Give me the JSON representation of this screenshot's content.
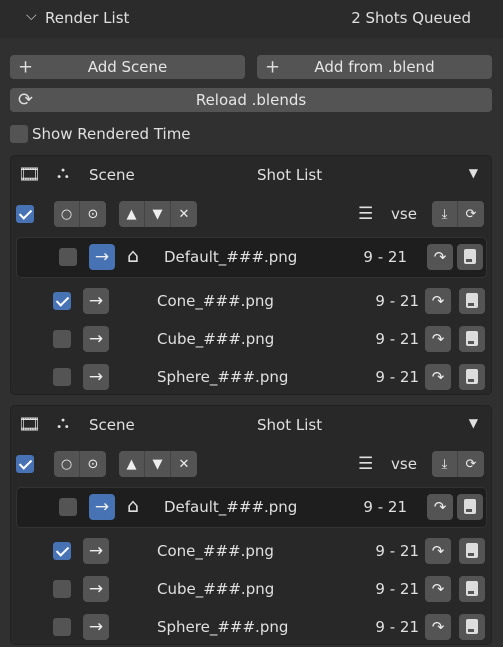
{
  "header": {
    "title": "Render List",
    "status": "2 Shots Queued"
  },
  "toolbar": {
    "add_scene": "Add Scene",
    "add_from_blend": "Add from .blend",
    "reload": "Reload .blends",
    "show_rendered_time": "Show Rendered Time",
    "show_rendered_time_checked": false
  },
  "colors": {
    "accent": "#4772b3",
    "button": "#545454",
    "panel": "#303030"
  },
  "blocks": [
    {
      "scene": "Scene",
      "list": "Shot List",
      "enabled": true,
      "collection": "vse",
      "default": {
        "name": "Default_###.png",
        "range": "9 - 21",
        "checked": false
      },
      "shots": [
        {
          "name": "Cone_###.png",
          "range": "9 - 21",
          "checked": true
        },
        {
          "name": "Cube_###.png",
          "range": "9 - 21",
          "checked": false
        },
        {
          "name": "Sphere_###.png",
          "range": "9 - 21",
          "checked": false
        }
      ]
    },
    {
      "scene": "Scene",
      "list": "Shot List",
      "enabled": true,
      "collection": "vse",
      "default": {
        "name": "Default_###.png",
        "range": "9 - 21",
        "checked": false
      },
      "shots": [
        {
          "name": "Cone_###.png",
          "range": "9 - 21",
          "checked": true
        },
        {
          "name": "Cube_###.png",
          "range": "9 - 21",
          "checked": false
        },
        {
          "name": "Sphere_###.png",
          "range": "9 - 21",
          "checked": false
        }
      ]
    }
  ]
}
